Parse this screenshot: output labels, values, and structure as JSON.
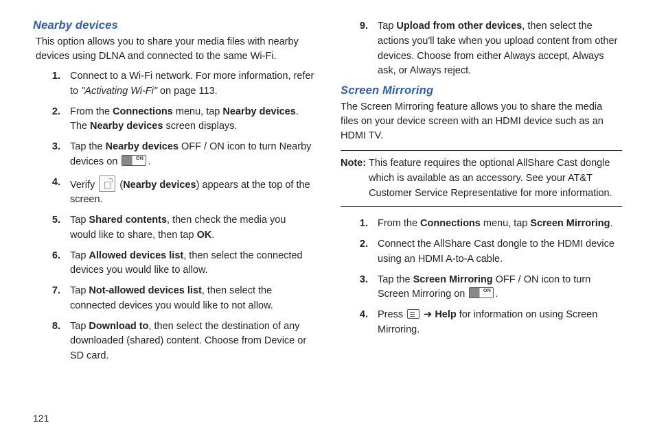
{
  "page_number": "121",
  "left": {
    "heading": "Nearby devices",
    "intro": "This option allows you to share your media files with nearby devices using DLNA and connected to the same Wi-Fi.",
    "steps": [
      {
        "n": "1.",
        "pre": "Connect to a Wi-Fi network. For more information, refer to ",
        "iref": "\"Activating Wi-Fi\"",
        "post": "  on page 113."
      },
      {
        "n": "2.",
        "pre": "From the ",
        "b1": "Connections",
        "mid": " menu, tap ",
        "b2": "Nearby devices",
        "post": ". The ",
        "b3": "Nearby devices",
        "tail": " screen displays."
      },
      {
        "n": "3.",
        "pre": "Tap the ",
        "b1": "Nearby devices",
        "mid": " OFF / ON icon to turn Nearby devices on ",
        "icon": "toggle",
        "post": "."
      },
      {
        "n": "4.",
        "pre": "Verify ",
        "icon": "nearby",
        "mid": " (",
        "b1": "Nearby devices",
        "post": ") appears at the top of the screen."
      },
      {
        "n": "5.",
        "pre": "Tap ",
        "b1": "Shared contents",
        "mid": ", then check the media you would like to share, then tap ",
        "b2": "OK",
        "post": "."
      },
      {
        "n": "6.",
        "pre": "Tap ",
        "b1": "Allowed devices list",
        "post": ", then select the connected devices you would like to allow."
      },
      {
        "n": "7.",
        "pre": "Tap ",
        "b1": "Not-allowed devices list",
        "post": ", then select the connected devices you would like to not allow."
      },
      {
        "n": "8.",
        "pre": "Tap ",
        "b1": "Download to",
        "post": ", then select the destination of any downloaded (shared) content. Choose from Device or SD card."
      }
    ]
  },
  "right": {
    "step9": {
      "n": "9.",
      "pre": "Tap ",
      "b1": "Upload from other devices",
      "post": ", then select the actions you'll take when you upload content from other devices. Choose from either Always accept, Always ask, or Always reject."
    },
    "heading": "Screen Mirroring",
    "intro": "The Screen Mirroring feature allows you to share the media files on your device screen with an HDMI device such as an HDMI TV.",
    "note_label": "Note:",
    "note_body": "This feature requires the optional AllShare Cast dongle which is available as an accessory. See your AT&T Customer Service Representative for more information.",
    "steps": [
      {
        "n": "1.",
        "pre": "From the ",
        "b1": "Connections",
        "mid": " menu, tap ",
        "b2": "Screen Mirroring",
        "post": "."
      },
      {
        "n": "2.",
        "pre": "Connect the AllShare Cast dongle to the HDMI device using an HDMI A-to-A cable."
      },
      {
        "n": "3.",
        "pre": "Tap the ",
        "b1": "Screen Mirroring",
        "mid": " OFF / ON icon to turn Screen Mirroring on ",
        "icon": "toggle",
        "post": "."
      },
      {
        "n": "4.",
        "pre": "Press ",
        "icon": "menu",
        "mid": " ➔ ",
        "b1": "Help",
        "post": " for information on using Screen Mirroring."
      }
    ]
  }
}
